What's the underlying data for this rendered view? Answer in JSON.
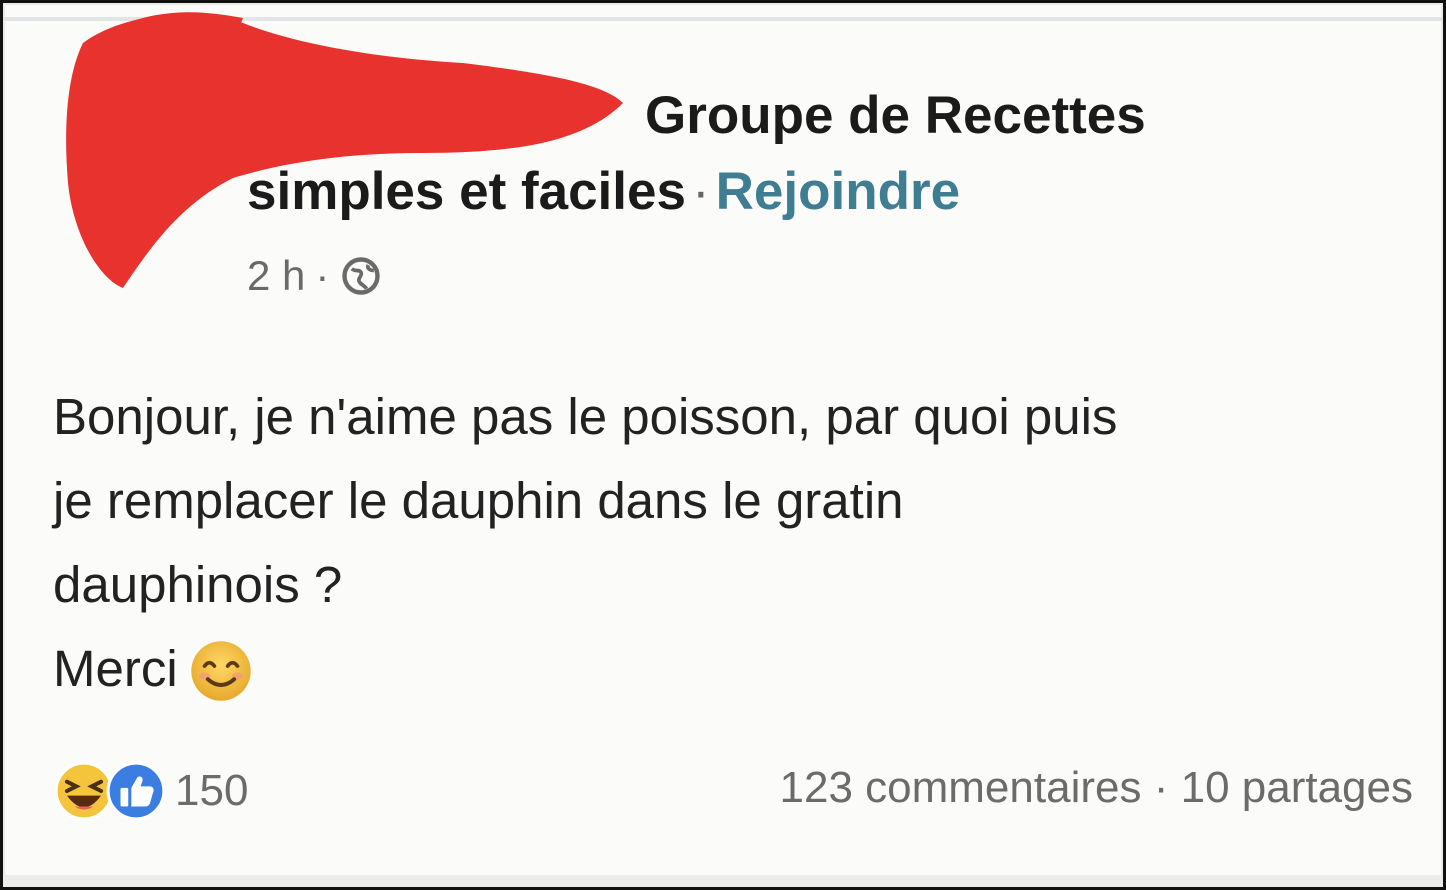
{
  "post": {
    "group_name_line1": "Groupe de Recettes",
    "group_name_line2": "simples et faciles",
    "separator": "·",
    "join_label": "Rejoindre",
    "time": "2 h",
    "meta_separator": "·",
    "privacy_icon": "globe-icon",
    "body_lines": [
      "Bonjour, je n'aime pas le poisson, par quoi puis",
      "je remplacer le dauphin dans le gratin",
      "dauphinois ?",
      "Merci"
    ],
    "body_emoji": "smiling-face-icon"
  },
  "engagement": {
    "reaction_icons": [
      "haha-icon",
      "like-icon"
    ],
    "reaction_count": "150",
    "comments": "123 commentaires",
    "stats_separator": "·",
    "shares": "10 partages"
  },
  "colors": {
    "redaction": "#e8322e",
    "link": "#3f7d93",
    "text": "#1b1b1b",
    "secondary_text": "#6b6b6b",
    "like_blue": "#3b7de0",
    "emoji_yellow": "#f2c13a"
  }
}
